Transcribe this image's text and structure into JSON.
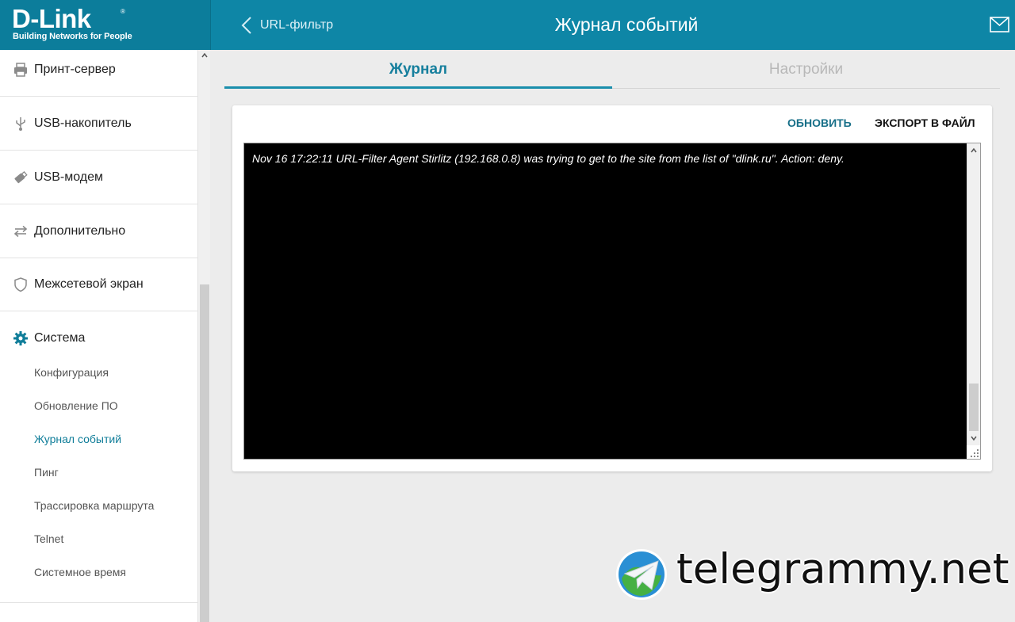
{
  "brand": {
    "logo": "D-Link",
    "tagline": "Building Networks for People",
    "reg_mark": "®"
  },
  "header": {
    "back_label": "URL-фильтр",
    "title": "Журнал событий",
    "mail_icon": "mail-icon"
  },
  "sidebar": {
    "items": [
      {
        "label": "Принт-сервер",
        "icon": "printer-icon"
      },
      {
        "label": "USB-накопитель",
        "icon": "usb-icon"
      },
      {
        "label": "USB-модем",
        "icon": "usb-modem-icon"
      },
      {
        "label": "Дополнительно",
        "icon": "transfer-arrows-icon"
      },
      {
        "label": "Межсетевой экран",
        "icon": "shield-icon"
      },
      {
        "label": "Система",
        "icon": "gear-icon"
      }
    ],
    "subitems": [
      {
        "label": "Конфигурация"
      },
      {
        "label": "Обновление ПО"
      },
      {
        "label": "Журнал событий",
        "active": true
      },
      {
        "label": "Пинг"
      },
      {
        "label": "Трассировка маршрута"
      },
      {
        "label": "Telnet"
      },
      {
        "label": "Системное время"
      }
    ]
  },
  "tabs": {
    "journal": "Журнал",
    "settings": "Настройки"
  },
  "log": {
    "refresh_label": "ОБНОВИТЬ",
    "export_label": "ЭКСПОРТ В ФАЙЛ",
    "content": "Nov 16 17:22:11 URL-Filter Agent Stirlitz (192.168.0.8) was trying to get to the site from the list of \"dlink.ru\". Action: deny."
  },
  "watermark": {
    "text": "telegrammy.net"
  },
  "colors": {
    "header": "#0e86a6",
    "accent": "#1a8eac",
    "active_link": "#0f7d99"
  }
}
